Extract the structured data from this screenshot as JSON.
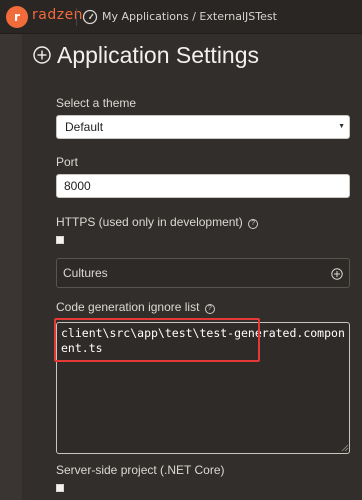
{
  "header": {
    "logo_mark": "r",
    "logo_text": "radzen",
    "breadcrumb_root": "My Applications",
    "breadcrumb_sep": "/",
    "breadcrumb_current": "ExternalJSTest"
  },
  "page": {
    "title": "Application Settings"
  },
  "theme": {
    "label": "Select a theme",
    "value": "Default",
    "options": [
      "Default"
    ]
  },
  "port": {
    "label": "Port",
    "value": "8000"
  },
  "https": {
    "label": "HTTPS (used only in development)",
    "help": "?",
    "checked": false
  },
  "cultures": {
    "label": "Cultures"
  },
  "codegen": {
    "label": "Code generation ignore list",
    "help": "?",
    "value": "client\\src\\app\\test\\test-generated.component.ts"
  },
  "server_side": {
    "label": "Server-side project (.NET Core)",
    "checked": false
  },
  "colors": {
    "brand": "#f26b3a",
    "highlight": "#e53935",
    "background": "#3a3532"
  }
}
